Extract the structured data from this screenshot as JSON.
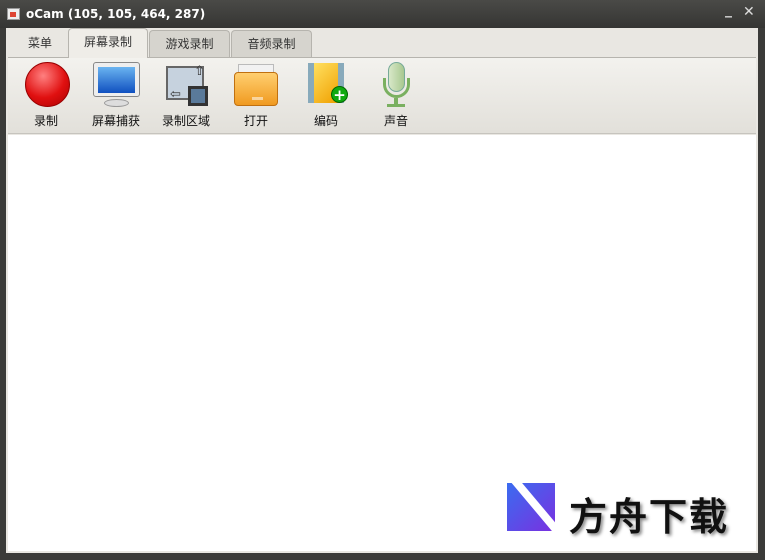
{
  "window": {
    "title": "oCam (105, 105, 464, 287)",
    "minimize": "_",
    "close": "✕"
  },
  "tabs": [
    {
      "label": "菜单"
    },
    {
      "label": "屏幕录制"
    },
    {
      "label": "游戏录制"
    },
    {
      "label": "音频录制"
    }
  ],
  "toolbar": [
    {
      "label": "录制",
      "icon": "record-icon"
    },
    {
      "label": "屏幕捕获",
      "icon": "monitor-icon"
    },
    {
      "label": "录制区域",
      "icon": "region-icon"
    },
    {
      "label": "打开",
      "icon": "folder-icon"
    },
    {
      "label": "编码",
      "icon": "film-add-icon"
    },
    {
      "label": "声音",
      "icon": "microphone-icon"
    }
  ],
  "watermark": {
    "text": "方舟下载"
  }
}
